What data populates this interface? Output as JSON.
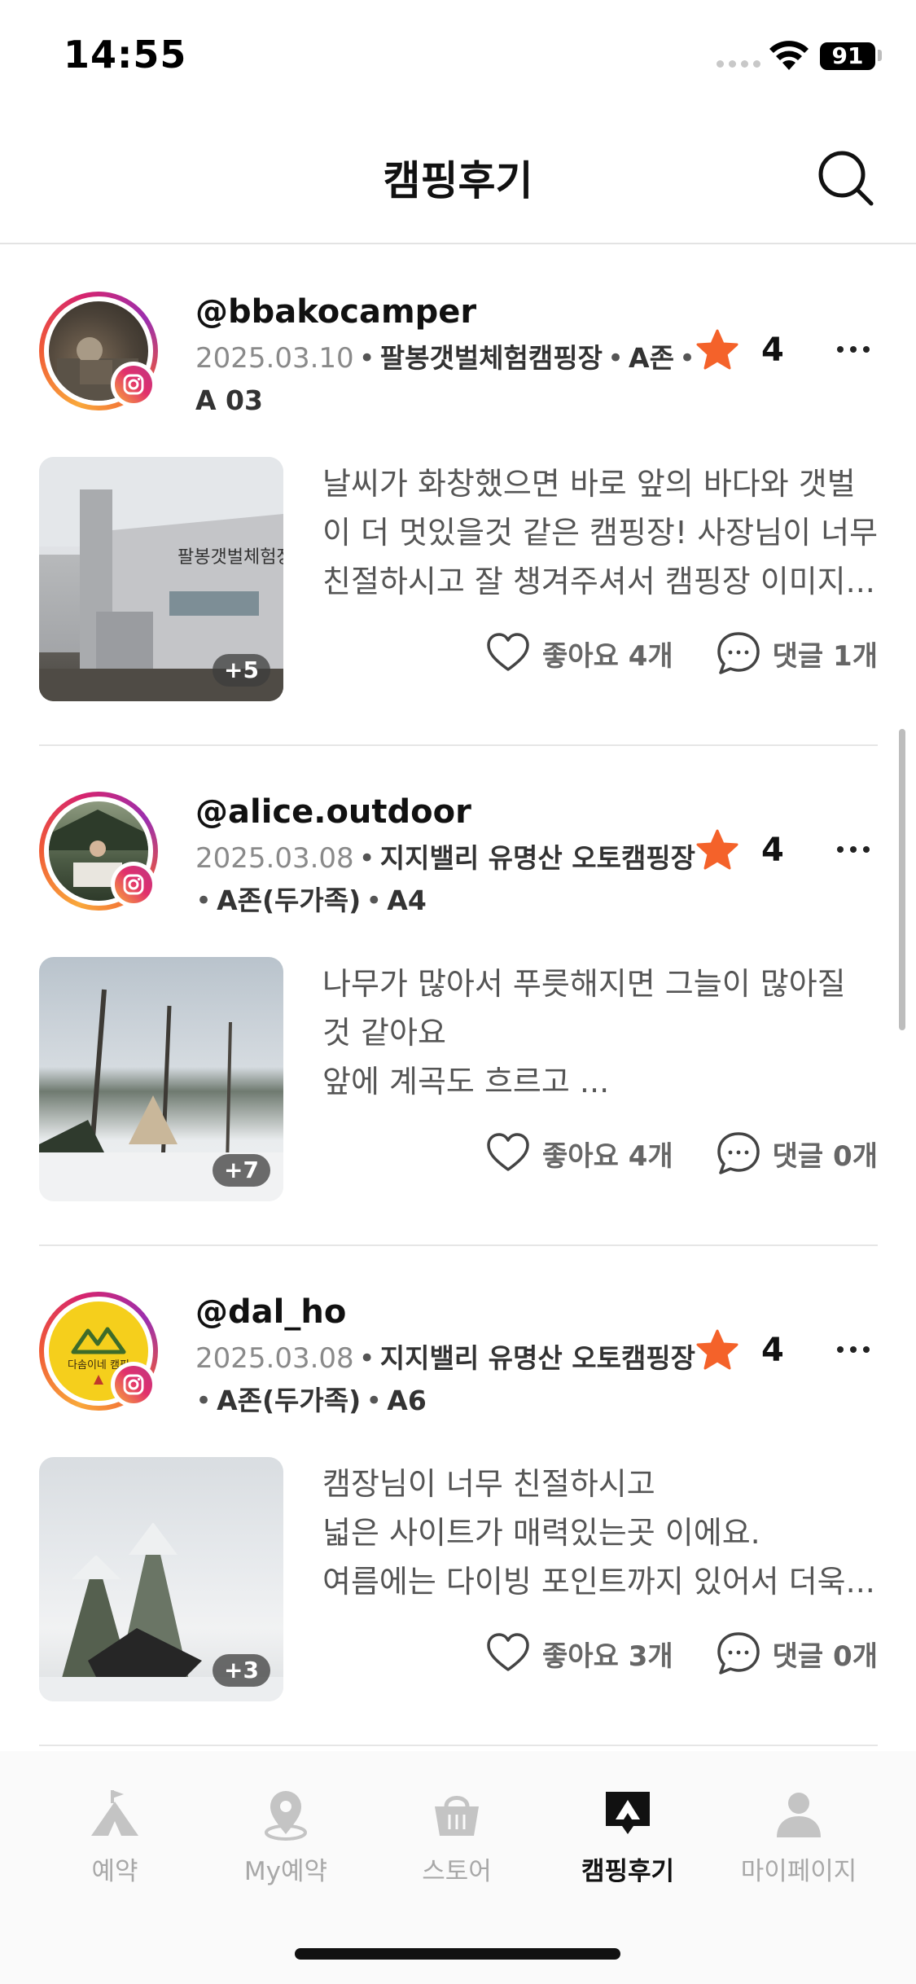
{
  "status_bar": {
    "time": "14:55",
    "battery": "91"
  },
  "header": {
    "title": "캠핑후기"
  },
  "reviews": [
    {
      "username": "@bbakocamper",
      "date": "2025.03.10",
      "place": "팔봉갯벌체험캠핑장",
      "zone": "A존",
      "site": "A 03",
      "rating": "4",
      "text": "날씨가 화창했으면 바로 앞의 바다와 갯벌\n이 더 멋있을것 같은 캠핑장! 사장님이 너무\n친절하시고 잘 챙겨주셔서 캠핑장 이미지...",
      "photo_count": "+5",
      "likes": "좋아요 4개",
      "comments": "댓글 1개"
    },
    {
      "username": "@alice.outdoor",
      "date": "2025.03.08",
      "place": "지지밸리 유명산 오토캠핑장",
      "zone": "A존(두가족)",
      "site": "A4",
      "rating": "4",
      "text": "나무가 많아서 푸릇해지면 그늘이 많아질\n것 같아요\n앞에 계곡도 흐르고 ...",
      "photo_count": "+7",
      "likes": "좋아요 4개",
      "comments": "댓글 0개"
    },
    {
      "username": "@dal_ho",
      "date": "2025.03.08",
      "place": "지지밸리 유명산 오토캠핑장",
      "zone": "A존(두가족)",
      "site": "A6",
      "rating": "4",
      "text": "캠장님이 너무 친절하시고\n넓은 사이트가 매력있는곳 이에요.\n여름에는 다이빙 포인트까지 있어서 더욱...",
      "photo_count": "+3",
      "likes": "좋아요 3개",
      "comments": "댓글 0개",
      "avatar_logo_text": "다솜이네 캠핑"
    }
  ],
  "bottom_nav": [
    {
      "label": "예약",
      "icon": "tent-flag-icon",
      "active": false
    },
    {
      "label": "My예약",
      "icon": "location-pin-icon",
      "active": false
    },
    {
      "label": "스토어",
      "icon": "shopping-basket-icon",
      "active": false
    },
    {
      "label": "캠핑후기",
      "icon": "review-chat-icon",
      "active": true
    },
    {
      "label": "마이페이지",
      "icon": "person-icon",
      "active": false
    }
  ],
  "colors": {
    "accent_star": "#f4622a",
    "text_primary": "#111111",
    "text_muted": "#8a8a8a",
    "nav_inactive": "#a8a8a8"
  }
}
